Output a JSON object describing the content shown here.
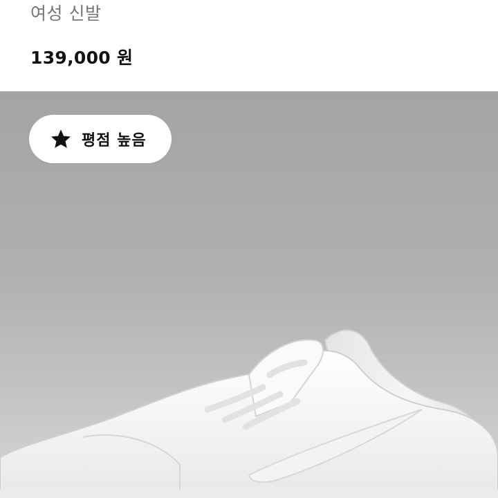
{
  "product": {
    "subtitle": "여성 신발",
    "price": "139,000 원"
  },
  "badge": {
    "label": "평점 높음",
    "icon": "star-icon"
  },
  "image": {
    "alt": "white low-top sneaker",
    "background": "#b0b0b0"
  }
}
